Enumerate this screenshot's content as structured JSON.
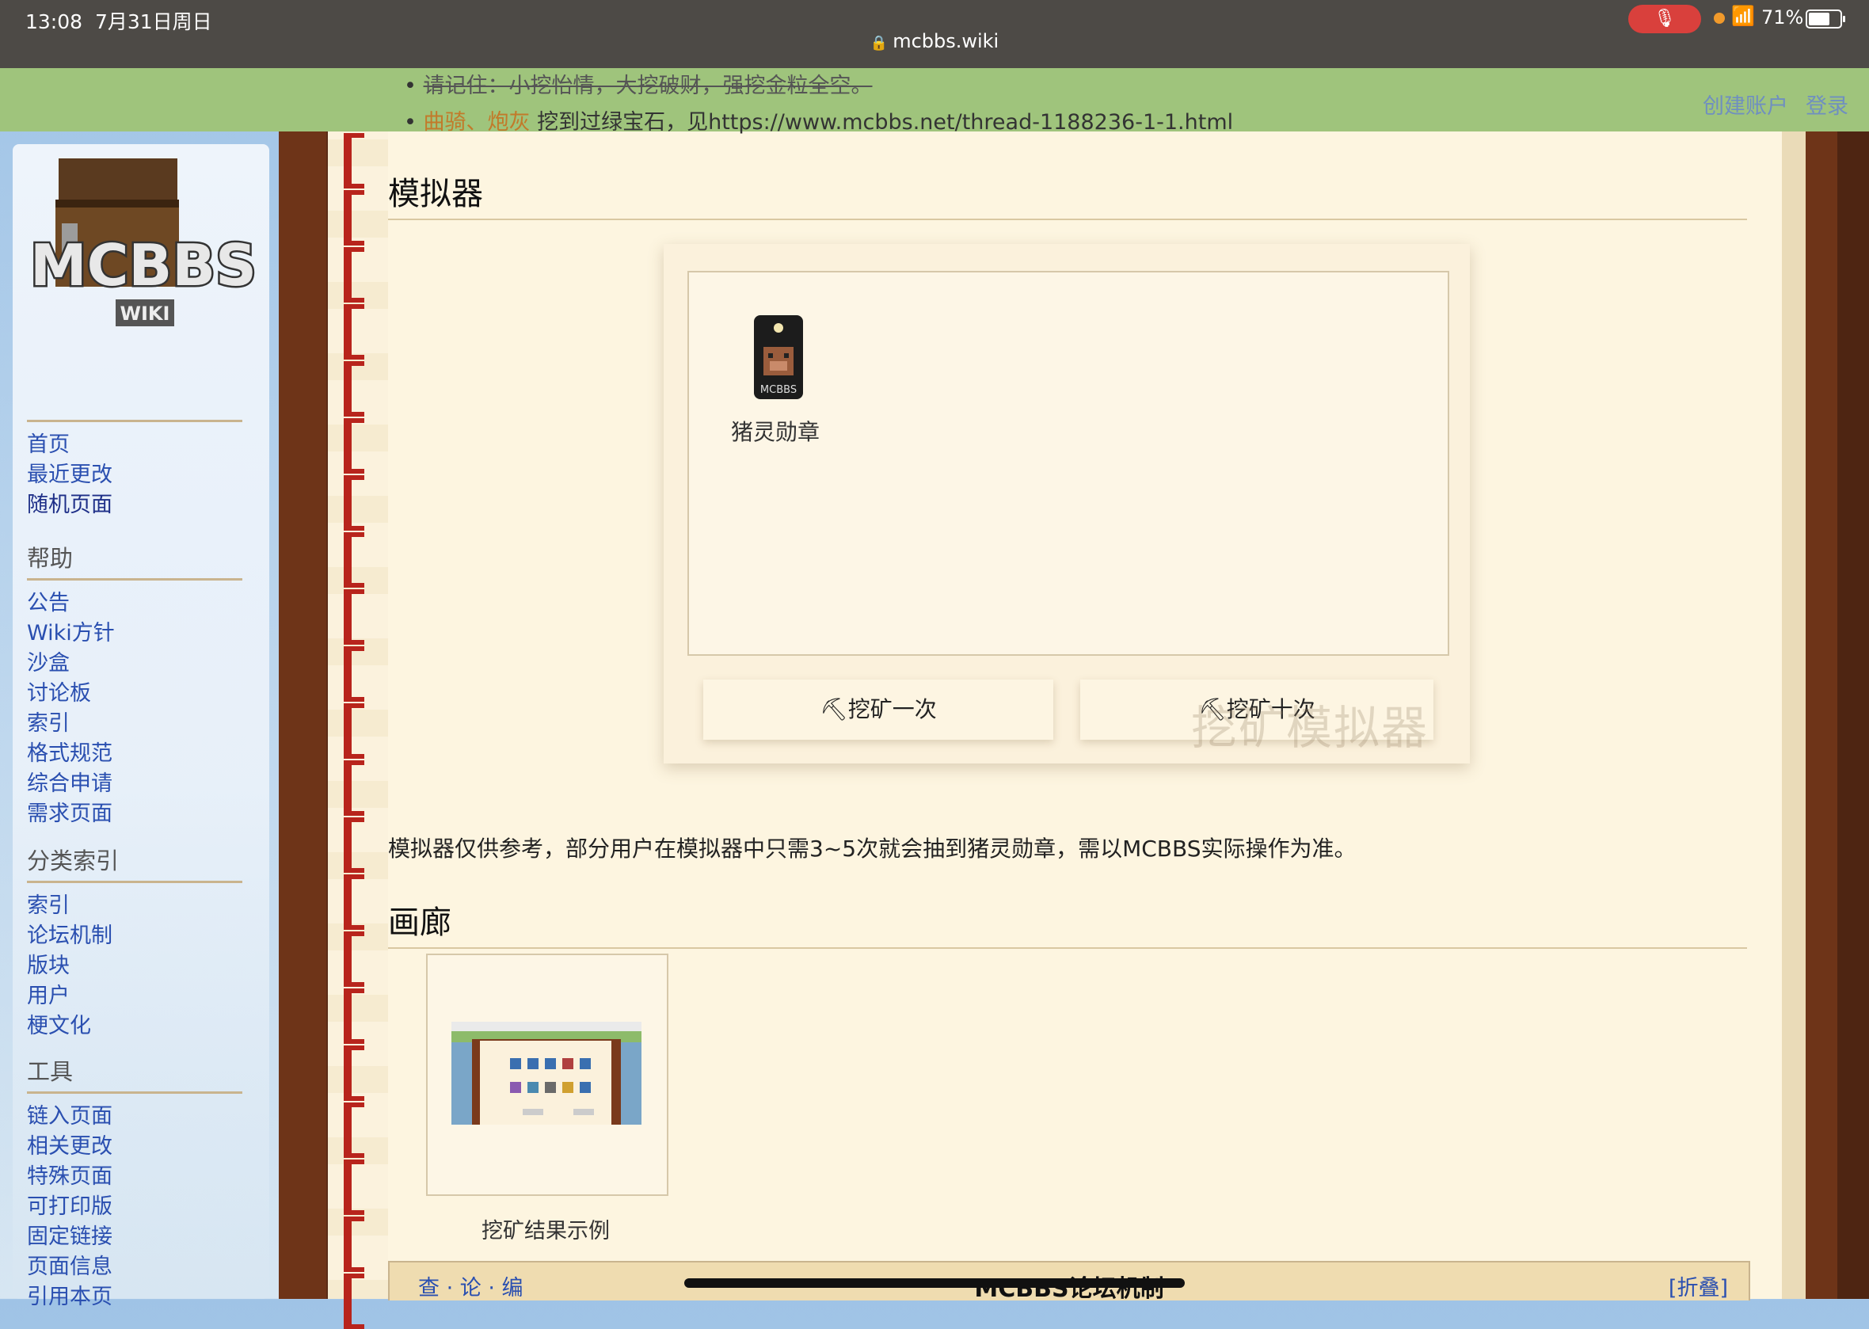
{
  "status_bar": {
    "time": "13:08",
    "date": "7月31日周日",
    "url": "mcbbs.wiki",
    "battery": "71%",
    "battery_level": 0.71
  },
  "header": {
    "create_account": "创建账户",
    "login": "登录"
  },
  "logo": {
    "title": "MCBBS",
    "subtitle": "WIKI"
  },
  "sidebar": {
    "main": [
      "首页",
      "最近更改",
      "随机页面"
    ],
    "help_title": "帮助",
    "help": [
      "公告",
      "Wiki方针",
      "沙盒",
      "讨论板",
      "索引",
      "格式规范",
      "综合申请",
      "需求页面"
    ],
    "category_title": "分类索引",
    "category": [
      "索引",
      "论坛机制",
      "版块",
      "用户",
      "梗文化"
    ],
    "tools_title": "工具",
    "tools": [
      "链入页面",
      "相关更改",
      "特殊页面",
      "可打印版",
      "固定链接",
      "页面信息",
      "引用本页"
    ]
  },
  "content": {
    "bullet1": "请记住：小挖怡情，大挖破财，强挖金粒全空。",
    "bullet2_name1": "曲骑",
    "bullet2_sep": "、",
    "bullet2_name2": "炮灰",
    "bullet2_rest": " 挖到过绿宝石，见https://www.mcbbs.net/thread-1188236-1-1.html",
    "simulator_heading": "模拟器",
    "badge_label": "猪灵勋章",
    "mine_once": "挖矿一次",
    "mine_ten": "挖矿十次",
    "watermark": "挖矿模拟器",
    "note": "模拟器仅供参考，部分用户在模拟器中只需3~5次就会抽到猪灵勋章，需以MCBBS实际操作为准。",
    "gallery_heading": "画廊",
    "gallery_caption": "挖矿结果示例",
    "navbox_links": [
      "查",
      "论",
      "编"
    ],
    "navbox_title": "MCBBS论坛机制",
    "navbox_toggle": "[折叠]"
  }
}
